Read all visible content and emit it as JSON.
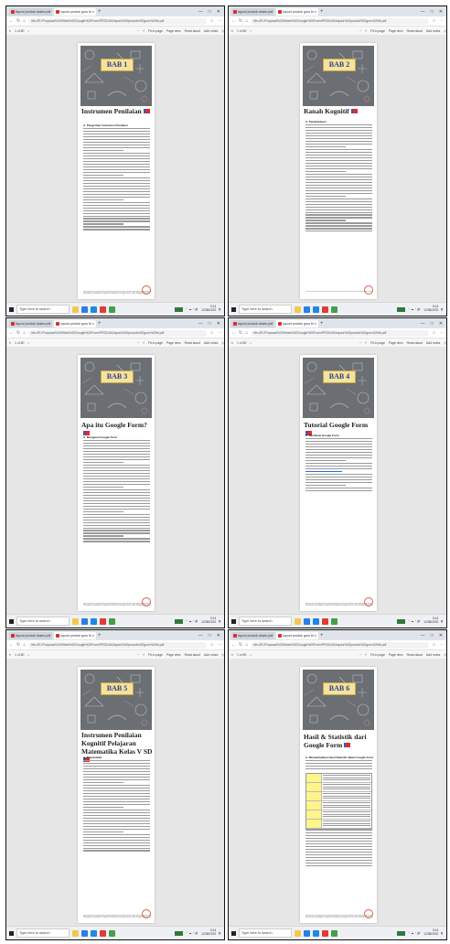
{
  "browser": {
    "tab_labels": [
      "layout produk dosen.pdf",
      "layout produk guru fe x"
    ],
    "new_tab": "+",
    "url": "file:///E:/Proposal%20Hibah%20Google%20Form/PRODUK/layout%20produk%20guru%20fe.pdf",
    "page_indicator": "1 of 80",
    "toolbar": {
      "zoom_in": "+",
      "zoom_out": "−",
      "fit": "Fit to page",
      "page_view": "Page view",
      "read_aloud": "Read aloud",
      "add_notes": "Add notes"
    },
    "window_controls": [
      "—",
      "□",
      "✕"
    ]
  },
  "taskbar": {
    "search_placeholder": "Type here to search",
    "clock_time": "9:14",
    "clock_date": "12/08/2022"
  },
  "chapters": [
    {
      "bab": "BAB 1",
      "title": "Instrumen Penilaian",
      "subheading": "A. Pengertian Instrumen Penilaian",
      "footer": "Panduan penilaian Kognitif berbasis Google Form dan Papan Pemandu bagi guru"
    },
    {
      "bab": "BAB 2",
      "title": "Ranah Kognitif",
      "subheading": "A. Pendahuluan",
      "footer": ""
    },
    {
      "bab": "BAB 3",
      "title": "Apa itu Google Form?",
      "subheading": "A. Mengenal Google Form",
      "footer": "Panduan penilaian Kognitif berbasis Google Form dan Papan Pemandu bagi guru"
    },
    {
      "bab": "BAB 4",
      "title": "Tutorial Google Form",
      "subheading": "A. Membuat Google Form",
      "footer": "Panduan penilaian Kognitif berbasis Google Form dan Papan Pemandu bagi guru"
    },
    {
      "bab": "BAB 5",
      "title": "Instrumen Penilaian Kognitif Pelajaran Matematika Kelas V SD",
      "subheading": "A. Matematika",
      "footer": "Panduan penilaian Kognitif berbasis Google Form dan Papan Pemandu bagi guru"
    },
    {
      "bab": "BAB 6",
      "title": "Hasil & Statistik dari Google Form",
      "subheading": "A. Memanfaatkan Hasil Statistik dalam Google Form",
      "footer": "Panduan penilaian Kognitif berbasis Google Form dan Papan Pemandu bagi guru"
    }
  ]
}
